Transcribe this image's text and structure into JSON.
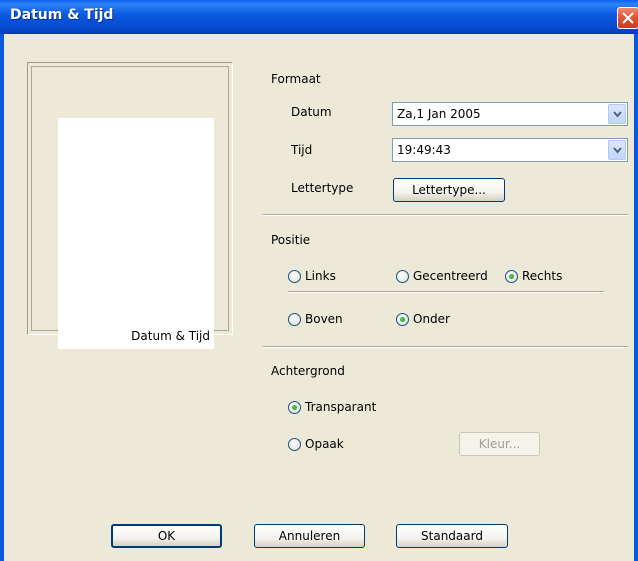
{
  "window": {
    "title": "Datum & Tijd"
  },
  "preview": {
    "stamp_text": "Datum & Tijd"
  },
  "format": {
    "heading": "Formaat",
    "date_label": "Datum",
    "date_value": "Za,1 Jan 2005",
    "time_label": "Tijd",
    "time_value": "19:49:43",
    "font_label": "Lettertype",
    "font_button": "Lettertype..."
  },
  "position": {
    "heading": "Positie",
    "options_horizontal": [
      {
        "label": "Links",
        "checked": false
      },
      {
        "label": "Gecentreerd",
        "checked": false
      },
      {
        "label": "Rechts",
        "checked": true
      }
    ],
    "options_vertical": [
      {
        "label": "Boven",
        "checked": false
      },
      {
        "label": "Onder",
        "checked": true
      }
    ]
  },
  "background": {
    "heading": "Achtergrond",
    "options": [
      {
        "label": "Transparant",
        "checked": true
      },
      {
        "label": "Opaak",
        "checked": false
      }
    ],
    "color_button": "Kleur..."
  },
  "footer": {
    "ok": "OK",
    "cancel": "Annuleren",
    "default": "Standaard"
  },
  "colors": {
    "titlebar": "#0a5ae0",
    "dialog_bg": "#ece9d8",
    "radio_dot": "#1e9a1e",
    "close_button": "#e0553a"
  }
}
